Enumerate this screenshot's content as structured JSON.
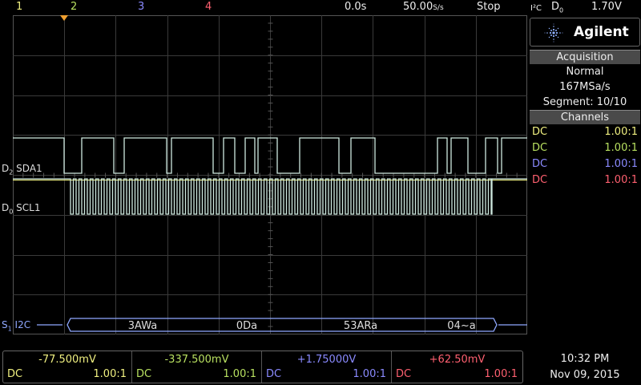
{
  "topbar": {
    "channels": [
      "1",
      "2",
      "3",
      "4"
    ],
    "time_ref": "0.0s",
    "sample_rate": "50.00",
    "sample_rate_unit": "S/s",
    "run_state": "Stop",
    "trigger_type": "I²C",
    "trigger_source": "D",
    "trigger_source_sub": "0",
    "trigger_level": "1.70V"
  },
  "waveforms": {
    "sda_prefix": "D",
    "sda_sub": "2",
    "sda_name": "SDA1",
    "scl_prefix": "D",
    "scl_sub": "0",
    "scl_name": "SCL1",
    "serial_prefix": "S",
    "serial_sub": "1",
    "serial_name": "I2C"
  },
  "decode": [
    "3AWa",
    "0Da",
    "53ARa",
    "04~a"
  ],
  "panel": {
    "brand": "Agilent",
    "acq_title": "Acquisition",
    "acq_mode": "Normal",
    "acq_rate": "167MSa/s",
    "acq_segment": "Segment: 10/10",
    "channels_title": "Channels",
    "channels": [
      {
        "coupling": "DC",
        "probe": "1.00:1"
      },
      {
        "coupling": "DC",
        "probe": "1.00:1"
      },
      {
        "coupling": "DC",
        "probe": "1.00:1"
      },
      {
        "coupling": "DC",
        "probe": "1.00:1"
      }
    ]
  },
  "measurements": [
    {
      "value": "-77.500mV",
      "coupling": "DC",
      "probe": "1.00:1"
    },
    {
      "value": "-337.500mV",
      "coupling": "DC",
      "probe": "1.00:1"
    },
    {
      "value": "+1.75000V",
      "coupling": "DC",
      "probe": "1.00:1"
    },
    {
      "value": "+62.50mV",
      "coupling": "DC",
      "probe": "1.00:1"
    }
  ],
  "clock": {
    "time": "10:32 PM",
    "date": "Nov 09, 2015"
  },
  "colors": {
    "ch1": "#f0f080",
    "ch2": "#b8e060",
    "ch3": "#8a8aff",
    "ch4": "#ff6070",
    "digital": "#cfeae0",
    "serial": "#8fa8ff",
    "grid": "#3a3a3a",
    "trigger_marker": "#f0a030"
  }
}
